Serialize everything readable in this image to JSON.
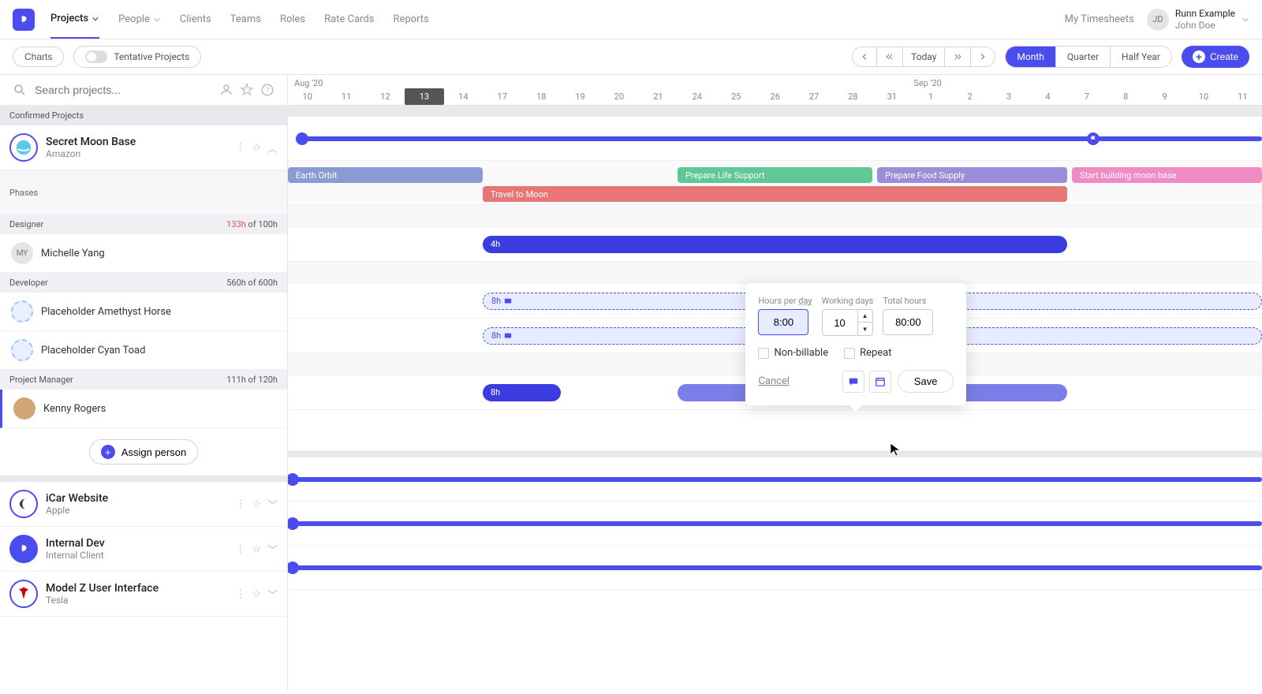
{
  "nav": {
    "items": [
      "Projects",
      "People",
      "Clients",
      "Teams",
      "Roles",
      "Rate Cards",
      "Reports"
    ],
    "my_timesheets": "My Timesheets",
    "user_initials": "JD",
    "user_name": "Runn Example",
    "user_sub": "John Doe"
  },
  "toolbar": {
    "charts": "Charts",
    "tentative": "Tentative Projects",
    "today": "Today",
    "periods": [
      "Month",
      "Quarter",
      "Half Year"
    ],
    "create": "Create"
  },
  "search": {
    "placeholder": "Search projects..."
  },
  "sidebar": {
    "confirmed_header": "Confirmed Projects",
    "project1": {
      "name": "Secret Moon Base",
      "client": "Amazon"
    },
    "phases_label": "Phases",
    "roles": [
      {
        "name": "Designer",
        "hours_used": "133h",
        "hours_total": " of 100h"
      },
      {
        "name": "Developer",
        "hours_used": "560h",
        "hours_total": " of 600h"
      },
      {
        "name": "Project Manager",
        "hours_used": "111h",
        "hours_total": " of 120h"
      }
    ],
    "people": {
      "michelle": {
        "initials": "MY",
        "name": "Michelle Yang"
      },
      "amethyst": "Placeholder Amethyst Horse",
      "cyan": "Placeholder Cyan Toad",
      "kenny": "Kenny Rogers"
    },
    "assign": "Assign person",
    "project2": {
      "name": "iCar Website",
      "client": "Apple"
    },
    "project3": {
      "name": "Internal Dev",
      "client": "Internal Client"
    },
    "project4": {
      "name": "Model Z User Interface",
      "client": "Tesla"
    }
  },
  "timeline": {
    "month1": "Aug '20",
    "month2": "Sep '20",
    "days": [
      "10",
      "11",
      "12",
      "13",
      "14",
      "17",
      "18",
      "19",
      "20",
      "21",
      "24",
      "25",
      "26",
      "27",
      "28",
      "31",
      "1",
      "2",
      "3",
      "4",
      "7",
      "8",
      "9",
      "10",
      "11"
    ],
    "today_index": 3,
    "phases": {
      "earth": "Earth Orbit",
      "life": "Prepare Life Support",
      "food": "Prepare Food Supply",
      "build": "Start building moon base",
      "travel": "Travel to Moon"
    },
    "alloc_4h": "4h",
    "alloc_8h": "8h"
  },
  "popover": {
    "hours_label_pre": "Hours per ",
    "hours_label_dashed": "day",
    "hours_value": "8:00",
    "days_label": "Working days",
    "days_value": "10",
    "total_label": "Total hours",
    "total_value": "80:00",
    "nonbillable": "Non-billable",
    "repeat": "Repeat",
    "cancel": "Cancel",
    "save": "Save"
  }
}
